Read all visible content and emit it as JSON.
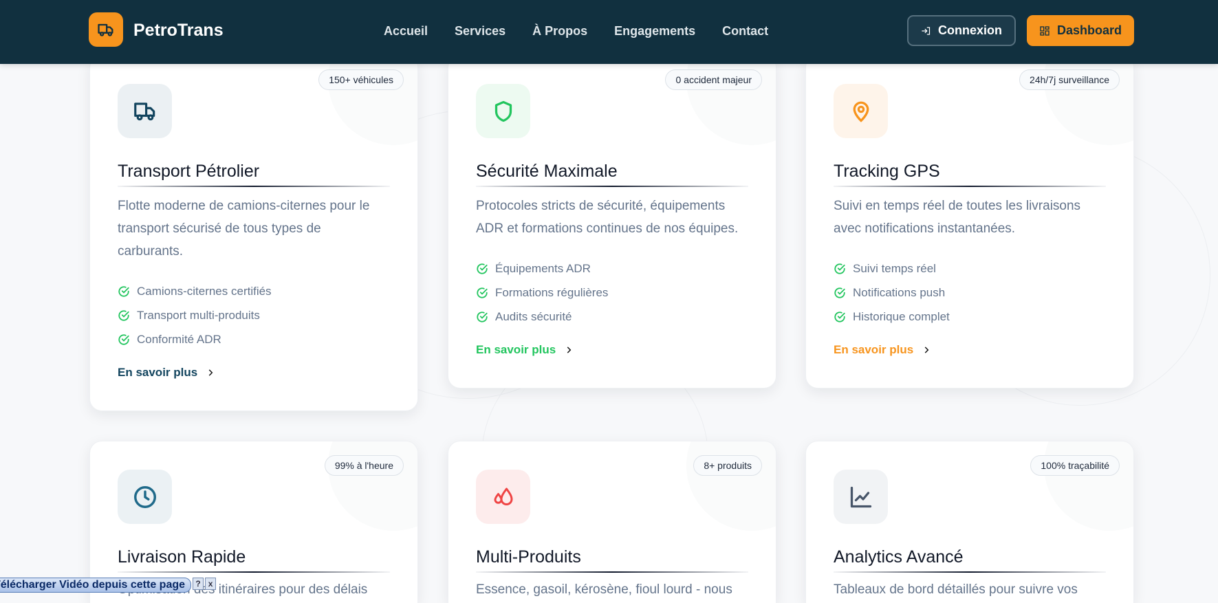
{
  "header": {
    "brand": "PetroTrans",
    "nav": [
      "Accueil",
      "Services",
      "À Propos",
      "Engagements",
      "Contact"
    ],
    "login": "Connexion",
    "dashboard": "Dashboard"
  },
  "cards": [
    {
      "badge": "150+ véhicules",
      "title": "Transport Pétrolier",
      "desc": "Flotte moderne de camions-citernes pour le transport sécurisé de tous types de carburants.",
      "features": [
        "Camions-citernes certifiés",
        "Transport multi-produits",
        "Conformité ADR"
      ],
      "link": "En savoir plus",
      "color": "#12445e"
    },
    {
      "badge": "0 accident majeur",
      "title": "Sécurité Maximale",
      "desc": "Protocoles stricts de sécurité, équipements ADR et formations continues de nos équipes.",
      "features": [
        "Équipements ADR",
        "Formations régulières",
        "Audits sécurité"
      ],
      "link": "En savoir plus",
      "color": "#22c55e"
    },
    {
      "badge": "24h/7j surveillance",
      "title": "Tracking GPS",
      "desc": "Suivi en temps réel de toutes les livraisons avec notifications instantanées.",
      "features": [
        "Suivi temps réel",
        "Notifications push",
        "Historique complet"
      ],
      "link": "En savoir plus",
      "color": "#f7941d"
    },
    {
      "badge": "99% à l'heure",
      "title": "Livraison Rapide",
      "desc": "Optimisation des itinéraires pour des délais"
    },
    {
      "badge": "8+ produits",
      "title": "Multi-Produits",
      "desc": "Essence, gasoil, kérosène, fioul lourd - nous"
    },
    {
      "badge": "100% traçabilité",
      "title": "Analytics Avancé",
      "desc": "Tableaux de bord détaillés pour suivre vos"
    }
  ],
  "overlay": {
    "label": "Télécharger Vidéo depuis cette page",
    "help": "?",
    "close": "x"
  }
}
